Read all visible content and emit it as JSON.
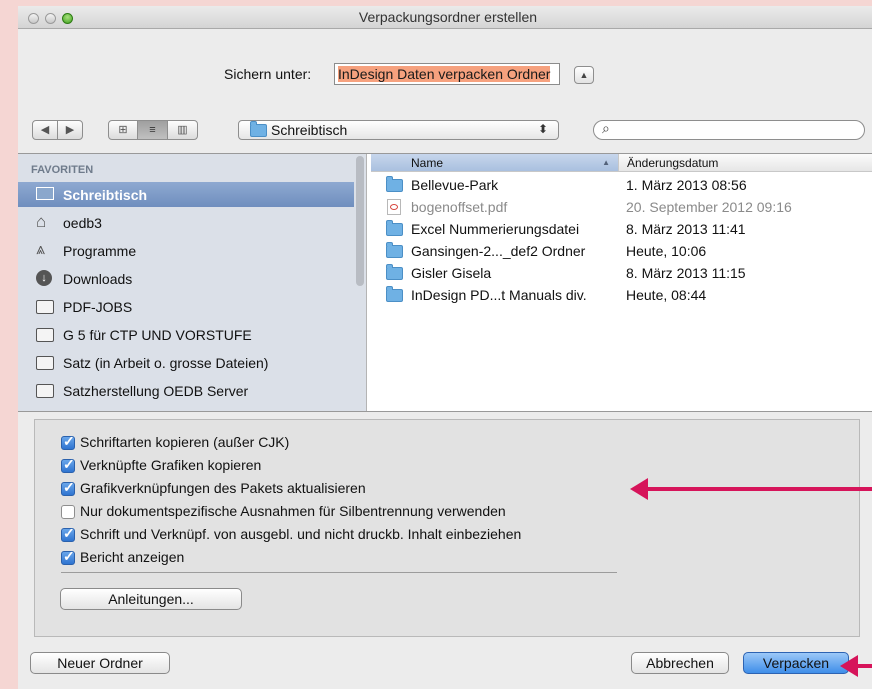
{
  "window": {
    "title": "Verpackungsordner erstellen"
  },
  "save": {
    "label": "Sichern unter:",
    "value": "InDesign Daten verpacken Ordner"
  },
  "toolbar": {
    "back": "◀",
    "forward": "▶",
    "view_icon": "⊞",
    "view_list": "≡",
    "view_columns": "▥"
  },
  "location": {
    "selected": "Schreibtisch",
    "arrows": "⬍"
  },
  "search": {
    "icon": "⌕",
    "placeholder": ""
  },
  "sidebar": {
    "header": "FAVORITEN",
    "items": [
      {
        "label": "Schreibtisch",
        "icon": "desktop-icon",
        "selected": true
      },
      {
        "label": "oedb3",
        "icon": "home-icon"
      },
      {
        "label": "Programme",
        "icon": "applications-icon"
      },
      {
        "label": "Downloads",
        "icon": "downloads-icon"
      },
      {
        "label": "PDF-JOBS",
        "icon": "folder-icon"
      },
      {
        "label": "G 5 für CTP UND VORSTUFE",
        "icon": "folder-icon"
      },
      {
        "label": "Satz (in Arbeit o. grosse Dateien)",
        "icon": "folder-icon"
      },
      {
        "label": "Satzherstellung OEDB Server",
        "icon": "folder-icon"
      }
    ]
  },
  "files": {
    "columns": {
      "name": "Name",
      "sort_indicator": "▲",
      "date": "Änderungsdatum"
    },
    "rows": [
      {
        "name": "Bellevue-Park",
        "date": "1. März 2013 08:56",
        "type": "folder"
      },
      {
        "name": "bogenoffset.pdf",
        "date": "20. September 2012 09:16",
        "type": "pdf",
        "dimmed": true
      },
      {
        "name": "Excel Nummerierungsdatei",
        "date": "8. März 2013 11:41",
        "type": "folder"
      },
      {
        "name": "Gansingen-2..._def2 Ordner",
        "date": "Heute, 10:06",
        "type": "folder"
      },
      {
        "name": "Gisler Gisela",
        "date": "8. März 2013 11:15",
        "type": "folder"
      },
      {
        "name": "InDesign PD...t Manuals div.",
        "date": "Heute, 08:44",
        "type": "folder"
      }
    ]
  },
  "options": {
    "items": [
      {
        "label": "Schriftarten kopieren (außer CJK)",
        "checked": true
      },
      {
        "label": "Verknüpfte Grafiken kopieren",
        "checked": true
      },
      {
        "label": "Grafikverknüpfungen des Pakets aktualisieren",
        "checked": true
      },
      {
        "label": "Nur dokumentspezifische Ausnahmen für Silbentrennung verwenden",
        "checked": false
      },
      {
        "label": "Schrift und Verknüpf. von ausgebl. und nicht druckb. Inhalt einbeziehen",
        "checked": true
      },
      {
        "label": "Bericht anzeigen",
        "checked": true
      }
    ],
    "instructions_button": "Anleitungen..."
  },
  "buttons": {
    "new_folder": "Neuer Ordner",
    "cancel": "Abbrechen",
    "package": "Verpacken"
  },
  "colors": {
    "annotation_arrow": "#d6145a",
    "selection": "#f6a17e",
    "default_button": "#3f8ee9"
  }
}
